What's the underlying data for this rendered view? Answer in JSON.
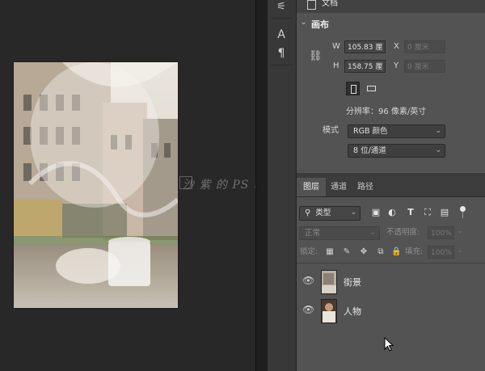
{
  "properties": {
    "tab_label": "文档",
    "section_title": "画布",
    "w_label": "W",
    "w_value": "105.83 厘",
    "h_label": "H",
    "h_value": "158.75 厘",
    "x_label": "X",
    "x_value": "0 厘米",
    "y_label": "Y",
    "y_value": "0 厘米",
    "resolution": "分辨率：96 像素/英寸",
    "mode_label": "模式",
    "mode_value": "RGB 颜色",
    "depth_value": "8 位/通道"
  },
  "tools": {
    "char": "A",
    "para": "¶"
  },
  "watermark": "沙 紫 的 PS 笔 记",
  "layers_panel": {
    "tabs": [
      "图层",
      "通道",
      "路径"
    ],
    "filter_kind": "类型",
    "blend_mode": "正常",
    "opacity_label": "不透明度:",
    "opacity_value": "100%",
    "lock_label": "锁定:",
    "fill_label": "填充:",
    "fill_value": "100%",
    "layers": [
      {
        "name": "街景"
      },
      {
        "name": "人物"
      }
    ]
  },
  "colors": {
    "panel_bg": "#535353",
    "canvas_bg": "#282828",
    "tab_active": "#535353"
  }
}
